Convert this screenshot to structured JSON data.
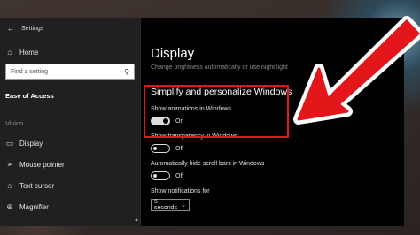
{
  "window": {
    "title": "Settings"
  },
  "sidebar": {
    "home_label": "Home",
    "search_placeholder": "Find a setting",
    "section_label": "Ease of Access",
    "group_label": "Vision",
    "items": [
      {
        "label": "Display",
        "icon": "monitor-icon"
      },
      {
        "label": "Mouse pointer",
        "icon": "mouse-pointer-icon"
      },
      {
        "label": "Text cursor",
        "icon": "text-cursor-icon"
      },
      {
        "label": "Magnifier",
        "icon": "magnifier-icon"
      }
    ]
  },
  "main": {
    "title": "Display",
    "subtitle": "Change brightness automatically or use night light",
    "section_title": "Simplify and personalize Windows",
    "settings": [
      {
        "label": "Show animations in Windows",
        "state": "On",
        "value": true
      },
      {
        "label": "Show transparency in Windows",
        "state": "Off",
        "value": false
      },
      {
        "label": "Automatically hide scroll bars in Windows",
        "state": "Off",
        "value": false
      }
    ],
    "notifications": {
      "label": "Show notifications for",
      "value": "5 seconds"
    }
  },
  "annotation": {
    "color": "#e3161a"
  }
}
